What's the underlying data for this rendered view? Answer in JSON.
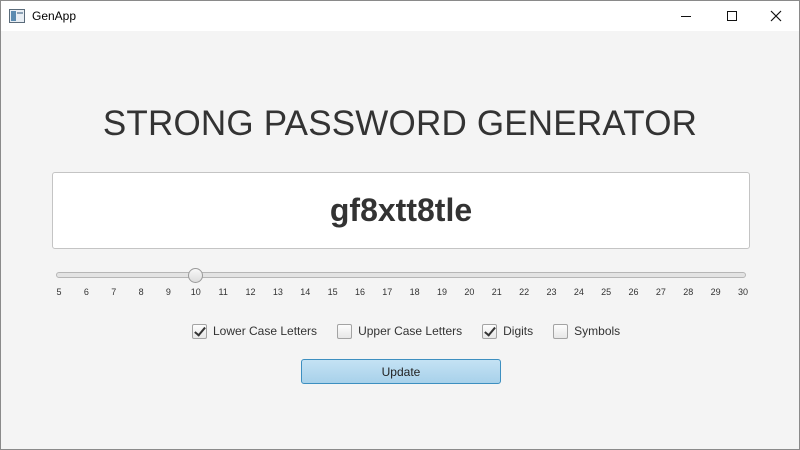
{
  "window": {
    "title": "GenApp"
  },
  "heading": "STRONG PASSWORD GENERATOR",
  "password": "gf8xtt8tle",
  "slider": {
    "min": 5,
    "max": 30,
    "value": 10,
    "ticks": [
      "5",
      "6",
      "7",
      "8",
      "9",
      "10",
      "11",
      "12",
      "13",
      "14",
      "15",
      "16",
      "17",
      "18",
      "19",
      "20",
      "21",
      "22",
      "23",
      "24",
      "25",
      "26",
      "27",
      "28",
      "29",
      "30"
    ]
  },
  "options": [
    {
      "label": "Lower Case Letters",
      "checked": true
    },
    {
      "label": "Upper Case Letters",
      "checked": false
    },
    {
      "label": "Digits",
      "checked": true
    },
    {
      "label": "Symbols",
      "checked": false
    }
  ],
  "update_label": "Update",
  "colors": {
    "button_fill": "#b6daf0",
    "button_border": "#3d8fc0",
    "background": "#f4f4f4"
  }
}
